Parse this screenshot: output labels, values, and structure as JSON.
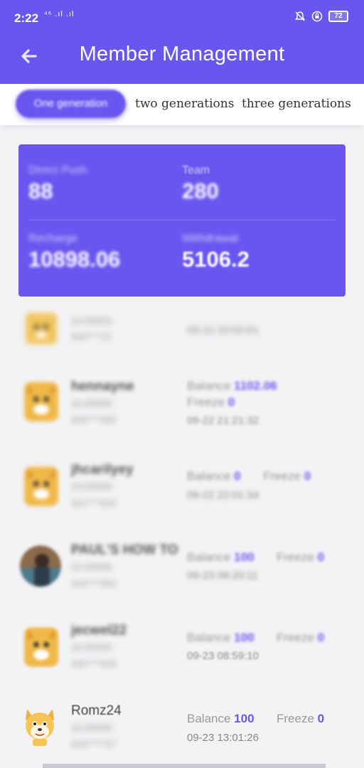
{
  "status_bar": {
    "time": "2:22",
    "network": "⁴⁶ .ıl .ıl",
    "battery": "72"
  },
  "header": {
    "title": "Member Management"
  },
  "tabs": [
    {
      "label": "One generation",
      "active": true
    },
    {
      "label": "two generations",
      "active": false
    },
    {
      "label": "three generations",
      "active": false
    }
  ],
  "summary": {
    "direct_push_label": "Direct Push",
    "direct_push_value": "88",
    "team_label": "Team",
    "team_value": "280",
    "recharge_label": "Recharge",
    "recharge_value": "10898.06",
    "withdrawal_label": "Withdrawal",
    "withdrawal_value": "5106.2"
  },
  "members": [
    {
      "name": "",
      "id": "20:5f5f5f3",
      "phone": "999****22",
      "date": "09-22 20:50:51",
      "avatar": "doge"
    },
    {
      "name": "hennayne",
      "id": "20:5f5f5f5",
      "phone": "909****565",
      "balance_label": "Balance",
      "balance": "1102.06",
      "freeze_label": "Freeze",
      "freeze": "0",
      "date": "09-22 21:21:32",
      "avatar": "doge"
    },
    {
      "name": "jhcarilyey",
      "id": "20:5f5f5f5",
      "phone": "921****820",
      "balance_label": "Balance",
      "balance": "0",
      "freeze_label": "Freeze",
      "freeze": "0",
      "date": "09-22 22:01:34",
      "avatar": "doge"
    },
    {
      "name": "PAUL'S HOW TO",
      "id": "20:5f5f5f5",
      "phone": "916****902",
      "balance_label": "Balance",
      "balance": "100",
      "freeze_label": "Freeze",
      "freeze": "0",
      "date": "09-23 06:20:11",
      "avatar": "photo"
    },
    {
      "name": "jecwel22",
      "id": "20:5f5f5f5",
      "phone": "930****049",
      "balance_label": "Balance",
      "balance": "100",
      "freeze_label": "Freeze",
      "freeze": "0",
      "date": "09-23 08:59:10",
      "avatar": "doge"
    },
    {
      "name": "Romz24",
      "id": "20:5f5f5f5",
      "phone": "929****757",
      "balance_label": "Balance",
      "balance": "100",
      "freeze_label": "Freeze",
      "freeze": "0",
      "date": "09-23 13:01:26",
      "avatar": "doge"
    }
  ],
  "colors": {
    "primary": "#6a55ef",
    "background": "#f3f3f6"
  }
}
